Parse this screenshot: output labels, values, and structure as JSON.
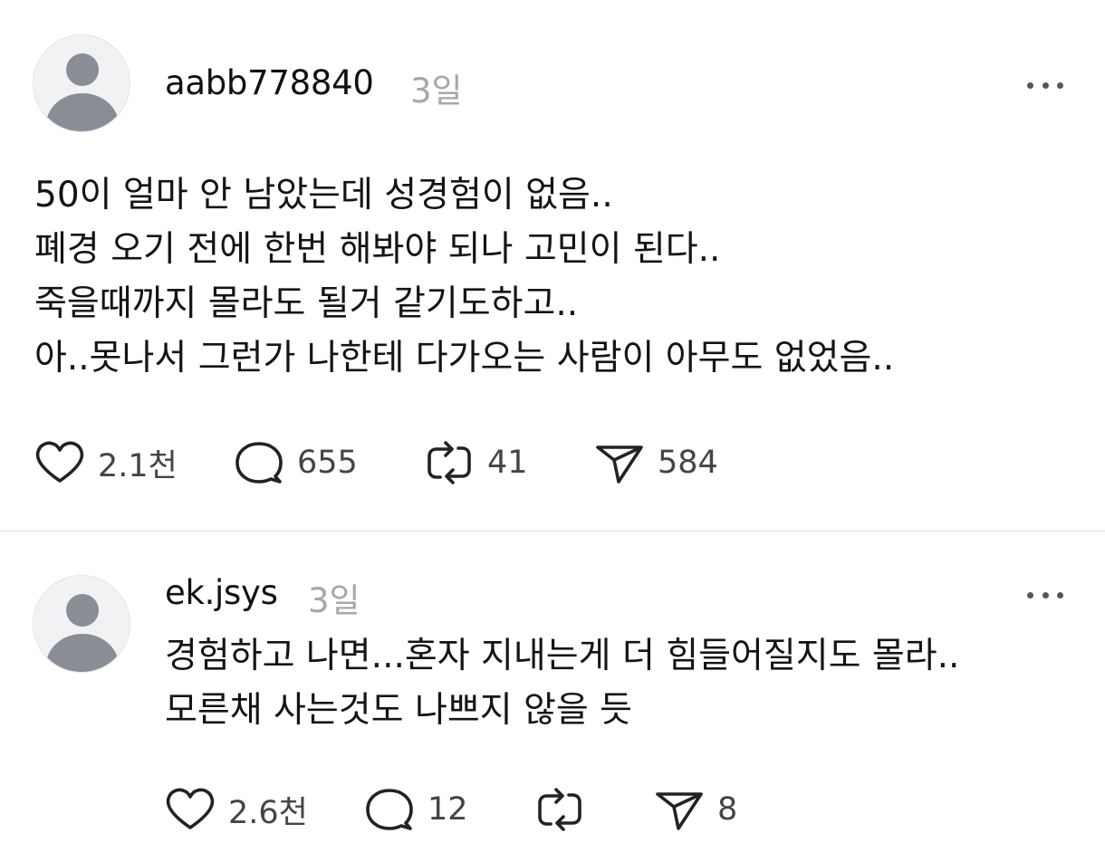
{
  "posts": [
    {
      "username": "aabb778840",
      "time": "3일",
      "lines": [
        "50이 얼마 안 남았는데 성경험이 없음..",
        "폐경 오기 전에 한번 해봐야 되나 고민이 된다..",
        "죽을때까지 몰라도 될거 같기도하고..",
        "아..못나서 그런가 나한테 다가오는 사람이 아무도 없었음.."
      ],
      "likes": "2.1천",
      "comments": "655",
      "reposts": "41",
      "shares": "584"
    },
    {
      "username": "ek.jsys",
      "time": "3일",
      "lines": [
        "경험하고 나면...혼자 지내는게 더 힘들어질지도 몰라..",
        "모른채 사는것도 나쁘지 않을 듯"
      ],
      "likes": "2.6천",
      "comments": "12",
      "reposts": "",
      "shares": "8"
    }
  ],
  "icons": {
    "avatar": "default-avatar-icon",
    "more": "more-horizontal-icon",
    "like": "heart-icon",
    "comment": "comment-bubble-icon",
    "repost": "repost-icon",
    "share": "send-icon"
  },
  "colors": {
    "text": "#141414",
    "muted": "#a7a7a7",
    "icon": "#222222",
    "avatar_bg": "#f1f2f3",
    "avatar_figure": "#8a8c96",
    "divider": "#dcdcdc"
  }
}
